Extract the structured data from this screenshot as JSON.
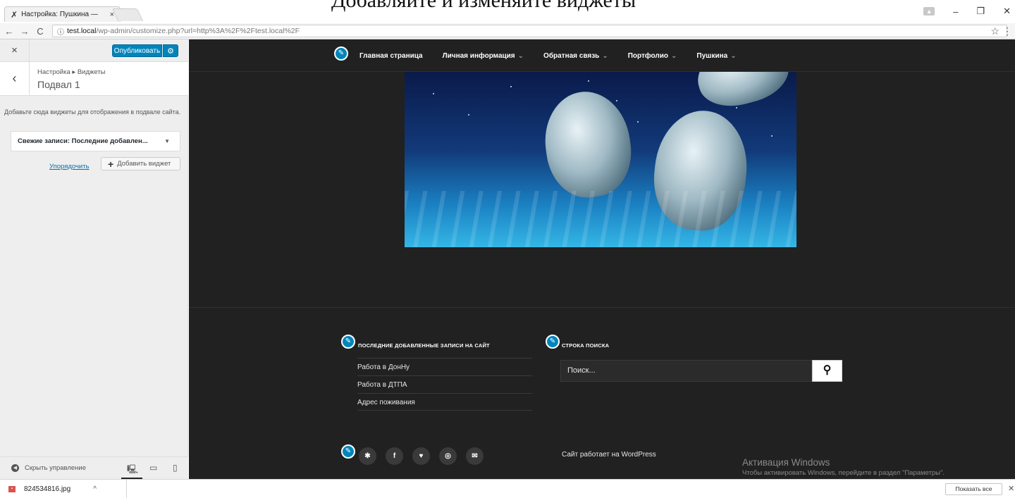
{
  "overlay_heading": "Добавляйте и изменяйте виджеты",
  "browser": {
    "tab_title": "Настройка: Пушкина —",
    "tab_close": "×",
    "url_host": "test.local",
    "url_path": "/wp-admin/customize.php?url=http%3A%2F%2Ftest.local%2F",
    "back": "←",
    "forward": "→",
    "reload": "C",
    "info_icon": "ⓘ",
    "star": "☆",
    "menu": "⋮",
    "win_minimize": "–",
    "win_restore": "❐",
    "win_close": "✕"
  },
  "sidebar": {
    "close": "×",
    "publish_label": "Опубликовать",
    "gear": "⚙",
    "back": "‹",
    "breadcrumb": "Настройка ▸ Виджеты",
    "section_title": "Подвал 1",
    "description": "Добавьте сюда виджеты для отображения в подвале сайта.",
    "widget_title": "Свежие записи: Последние добавлен...",
    "widget_toggle": "▼",
    "reorder_label": "Упорядочить",
    "add_widget_label": "Добавить виджет",
    "hide_controls_label": "Скрыть управление"
  },
  "preview": {
    "nav": [
      {
        "label": "Главная страница",
        "chevron": ""
      },
      {
        "label": "Личная информация",
        "chevron": "⌄"
      },
      {
        "label": "Обратная связь",
        "chevron": "⌄"
      },
      {
        "label": "Портфолио",
        "chevron": "⌄"
      },
      {
        "label": "Пушкина",
        "chevron": "⌄"
      }
    ],
    "recent_posts_title": "ПОСЛЕДНИЕ ДОБАВЛЕННЫЕ ЗАПИСИ НА САЙТ",
    "recent_posts": [
      "Работа в ДонНу",
      "Работа в ДТПА",
      "Адрес поживания"
    ],
    "search_title": "СТРОКА ПОИСКА",
    "search_placeholder": "Поиск...",
    "search_button_icon": "🔍",
    "social_icons": [
      "yelp-icon",
      "facebook-icon",
      "twitter-icon",
      "instagram-icon",
      "email-icon"
    ],
    "powered_by": "Сайт работает на WordPress",
    "windows_activation_title": "Активация Windows",
    "windows_activation_text": "Чтобы активировать Windows, перейдите в раздел \"Параметры\"."
  },
  "download_bar": {
    "file_name": "824534816.jpg",
    "caret": "^",
    "show_all": "Показать все",
    "close": "✕"
  },
  "colors": {
    "accent": "#0085ba",
    "preview_bg": "#212121",
    "link": "#0073aa"
  }
}
